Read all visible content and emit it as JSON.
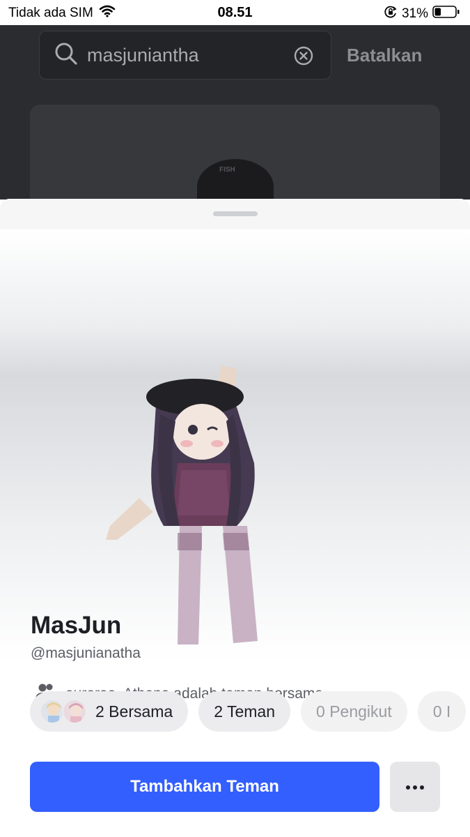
{
  "status_bar": {
    "carrier": "Tidak ada SIM",
    "time": "08.51",
    "battery_percent": "31%",
    "battery_level": 0.31,
    "icons": [
      "wifi-icon",
      "orientation-lock-icon",
      "battery-icon"
    ]
  },
  "search": {
    "query": "masjuniantha",
    "cancel_label": "Batalkan"
  },
  "profile": {
    "display_name": "MasJun",
    "username": "@masjunianatha",
    "mutual_friends_text": "auroraa, Athena adalah teman bersama"
  },
  "stats": [
    {
      "label": "2 Bersama",
      "muted": false
    },
    {
      "label": "2 Teman",
      "muted": false
    },
    {
      "label": "0 Pengikut",
      "muted": true
    },
    {
      "label": "0 I",
      "muted": true
    }
  ],
  "actions": {
    "add_friend_label": "Tambahkan Teman",
    "more_icon": "more-dots-icon"
  },
  "colors": {
    "primary_button": "#335fff",
    "backdrop": "#2b2c30",
    "chip_bg": "#ececee",
    "muted_text": "#9a9ca1"
  }
}
